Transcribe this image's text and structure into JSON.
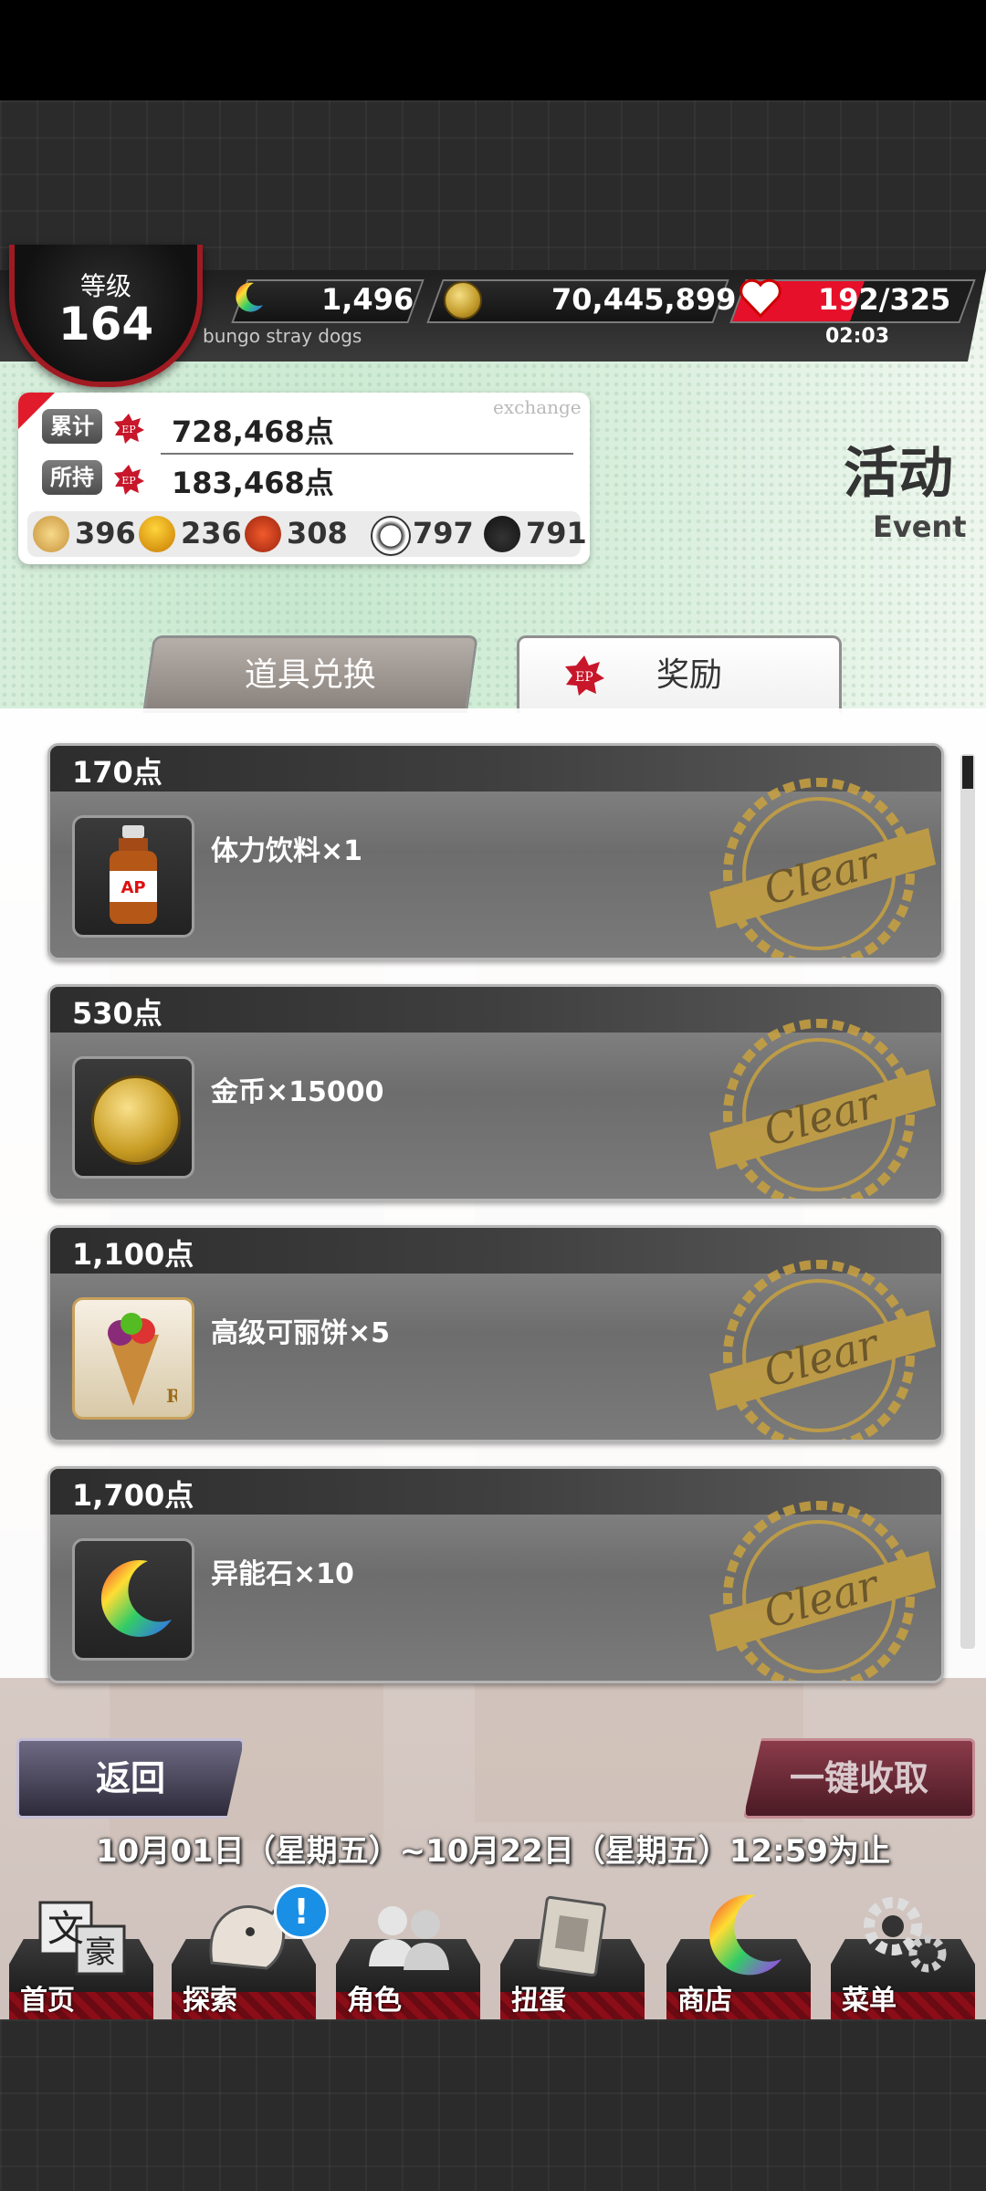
{
  "header": {
    "level_label": "等级",
    "level_value": "164",
    "gems": "1,496",
    "coins": "70,445,899",
    "stamina": "192/325",
    "stamina_timer": "02:03",
    "subtitle": "bungo stray dogs"
  },
  "points_panel": {
    "exchange_label": "exchange",
    "total_label": "累计",
    "total_value": "728,468点",
    "held_label": "所持",
    "held_value": "183,468点",
    "items": [
      {
        "icon": "pie-icon",
        "count": "396"
      },
      {
        "icon": "bell-icon",
        "count": "236"
      },
      {
        "icon": "fan-icon",
        "count": "308"
      },
      {
        "icon": "panda-icon",
        "count": "797"
      },
      {
        "icon": "hat-icon",
        "count": "791"
      }
    ]
  },
  "event": {
    "title": "活动",
    "subtitle": "Event"
  },
  "tabs": {
    "exchange": "道具兑换",
    "reward": "奖励",
    "reward_icon_text": "EP"
  },
  "rewards": [
    {
      "points": "170点",
      "item": "体力饮料×1",
      "icon": "energy-drink-icon",
      "status": "Clear"
    },
    {
      "points": "530点",
      "item": "金币×15000",
      "icon": "gold-coin-icon",
      "status": "Clear"
    },
    {
      "points": "1,100点",
      "item": "高级可丽饼×5",
      "icon": "crepe-icon",
      "status": "Clear"
    },
    {
      "points": "1,700点",
      "item": "异能石×10",
      "icon": "rainbow-moon-icon",
      "status": "Clear"
    }
  ],
  "controls": {
    "back": "返回",
    "collect_all": "一键收取",
    "period": "10月01日（星期五）~10月22日（星期五）12:59为止"
  },
  "nav": [
    {
      "label": "首页",
      "icon": "home-icon"
    },
    {
      "label": "探索",
      "icon": "explore-icon"
    },
    {
      "label": "角色",
      "icon": "characters-icon"
    },
    {
      "label": "扭蛋",
      "icon": "gacha-icon"
    },
    {
      "label": "商店",
      "icon": "shop-icon"
    },
    {
      "label": "菜单",
      "icon": "menu-icon"
    }
  ],
  "notification": "!",
  "colors": {
    "accent_red": "#e01c2c",
    "stamp_gold": "#c9a240"
  }
}
